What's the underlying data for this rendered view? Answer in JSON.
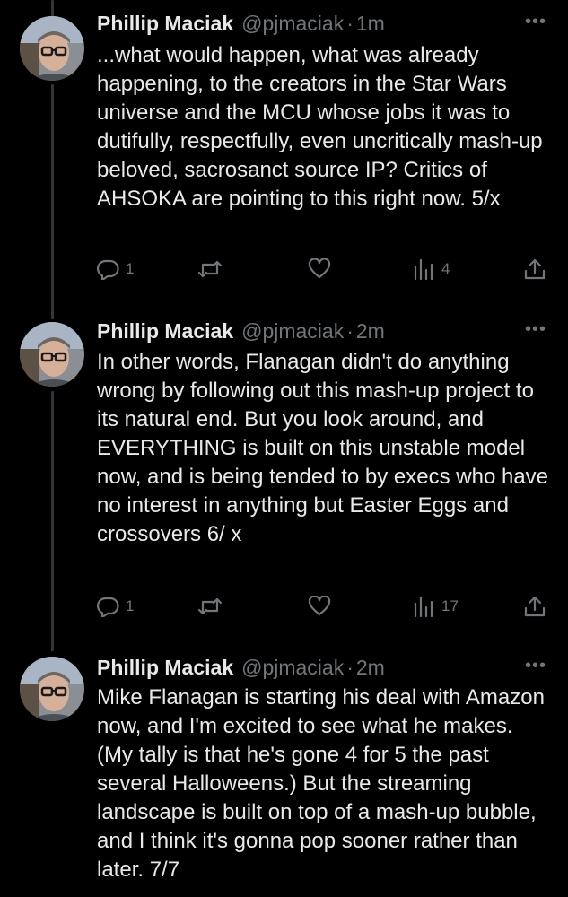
{
  "colors": {
    "background": "#000000",
    "text": "#e7e9ea",
    "muted": "#71767b",
    "thread_line": "#333639"
  },
  "tweets": [
    {
      "name": "Phillip Maciak",
      "handle": "@pjmaciak",
      "separator": "·",
      "time": "1m",
      "more_icon": "more-horizontal-icon",
      "text": "...what would happen, what was already happening, to the creators in the Star Wars universe and the MCU whose jobs it was to dutifully, respectfully, even uncritically mash-up beloved, sacrosanct source IP? Critics of AHSOKA are pointing to this right now. 5/x",
      "replies": "1",
      "views": "4"
    },
    {
      "name": "Phillip Maciak",
      "handle": "@pjmaciak",
      "separator": "·",
      "time": "2m",
      "more_icon": "more-horizontal-icon",
      "text": "In other words, Flanagan didn't do anything wrong by following out this mash-up project to its natural end. But you look around, and EVERYTHING is built on this unstable model now, and is being tended to by execs who have no interest in anything but Easter Eggs and crossovers 6/ x",
      "replies": "1",
      "views": "17"
    },
    {
      "name": "Phillip Maciak",
      "handle": "@pjmaciak",
      "separator": "·",
      "time": "2m",
      "more_icon": "more-horizontal-icon",
      "text": "Mike Flanagan is starting his deal with Amazon now, and I'm excited to see what he makes. (My tally is that he's gone 4 for 5 the past several Halloweens.) But the streaming landscape is built on top of a mash-up bubble, and I think it's gonna pop sooner rather than later. 7/7"
    }
  ]
}
